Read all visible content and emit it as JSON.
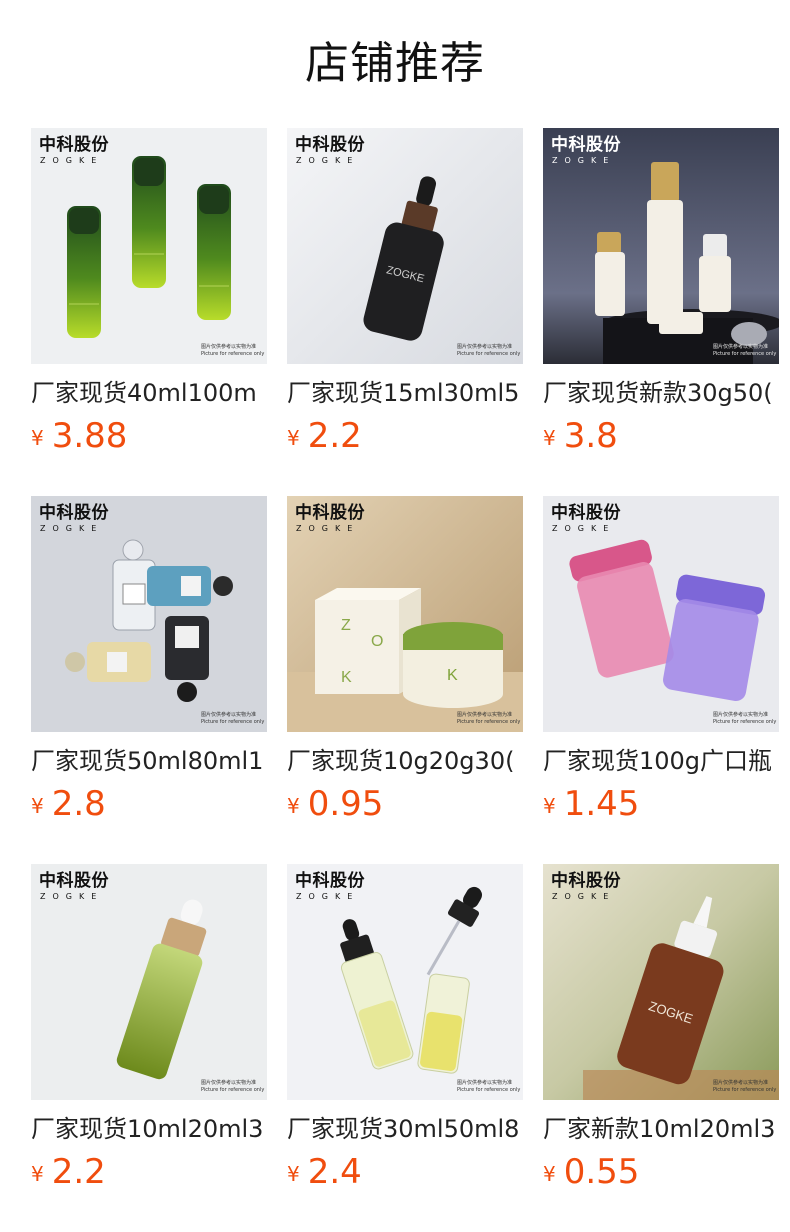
{
  "section_title": "店铺推荐",
  "brand": {
    "cn": "中科股份",
    "en": "ZOGKE"
  },
  "disclaimer": {
    "cn": "图片仅供参考以实物为准",
    "en": "Picture for reference only"
  },
  "currency_symbol": "¥",
  "colors": {
    "price": "#f04d0e",
    "title": "#111111",
    "text": "#222222"
  },
  "products": [
    {
      "name": "厂家现货40ml100m",
      "price": "3.88",
      "image": "green-bamboo-lotion-bottles",
      "brand_color": "dark"
    },
    {
      "name": "厂家现货15ml30ml5",
      "price": "2.2",
      "image": "black-dropper-bottle",
      "brand_color": "dark"
    },
    {
      "name": "厂家现货新款30g50(",
      "price": "3.8",
      "image": "cream-gold-bottle-set",
      "brand_color": "light"
    },
    {
      "name": "厂家现货50ml80ml1",
      "price": "2.8",
      "image": "glass-perfume-bottles",
      "brand_color": "dark"
    },
    {
      "name": "厂家现货10g20g30(",
      "price": "0.95",
      "image": "cream-jar-and-box",
      "brand_color": "dark"
    },
    {
      "name": "厂家现货100g广口瓶",
      "price": "1.45",
      "image": "pink-purple-jars",
      "brand_color": "dark"
    },
    {
      "name": "厂家现货10ml20ml3",
      "price": "2.2",
      "image": "green-dropper-wood-cap",
      "brand_color": "dark"
    },
    {
      "name": "厂家现货30ml50ml8",
      "price": "2.4",
      "image": "clear-dropper-bottles",
      "brand_color": "dark"
    },
    {
      "name": "厂家新款10ml20ml3",
      "price": "0.55",
      "image": "amber-bottle-white-cap",
      "brand_color": "dark"
    }
  ]
}
